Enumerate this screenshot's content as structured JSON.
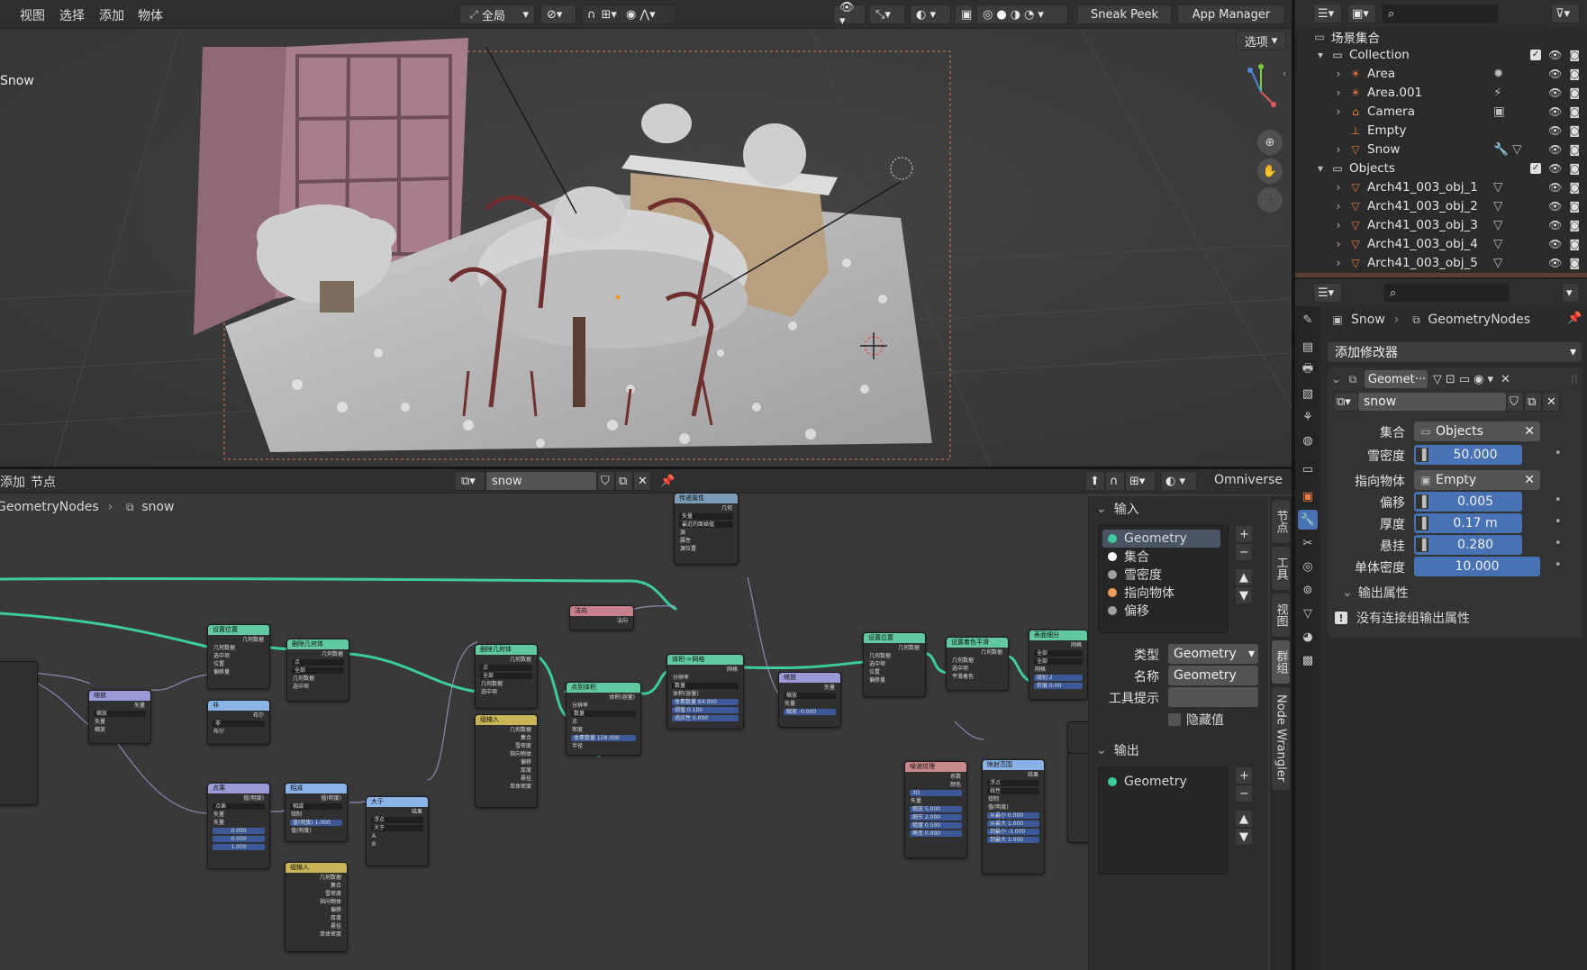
{
  "viewport": {
    "menu": [
      "视图",
      "选择",
      "添加",
      "物体"
    ],
    "orientation": "全局",
    "sneak_peek": "Sneak Peek",
    "app_manager": "App Manager",
    "options": "选项",
    "object_label": "Snow"
  },
  "node_editor": {
    "menu": [
      "添加",
      "节点"
    ],
    "tree_name": "snow",
    "omniverse": "Omniverse",
    "breadcrumb": [
      "GeometryNodes",
      "snow"
    ],
    "tabs": [
      "节点",
      "工具",
      "视图",
      "群组",
      "Node Wrangler"
    ],
    "inputs_header": "输入",
    "inputs": [
      {
        "name": "Geometry",
        "color": "#3dcc9f"
      },
      {
        "name": "集合",
        "color": "#ffffff"
      },
      {
        "name": "雪密度",
        "color": "#a1a1a1"
      },
      {
        "name": "指向物体",
        "color": "#ed9e5c"
      },
      {
        "name": "偏移",
        "color": "#a1a1a1"
      }
    ],
    "type_label": "类型",
    "type_value": "Geometry",
    "name_label": "名称",
    "name_value": "Geometry",
    "tooltip_label": "工具提示",
    "hide_value_label": "隐藏值",
    "outputs_header": "输出",
    "outputs": [
      {
        "name": "Geometry",
        "color": "#3dcc9f"
      }
    ],
    "nodes": [
      {
        "title": "传递属性",
        "color": "#7b9db8",
        "rows": [
          "几何",
          "矢量",
          "最近的面插值",
          "源",
          "属性",
          "源位置"
        ]
      },
      {
        "title": "法向",
        "color": "#c8808a",
        "rows": [
          "法向"
        ]
      },
      {
        "title": "设置位置",
        "color": "#60c9a2",
        "rows": [
          "几何数据",
          "几何数据",
          "选中项",
          "位置",
          "偏移量"
        ]
      },
      {
        "title": "删除几何体",
        "color": "#60c9a2",
        "rows": [
          "几何数据",
          "点",
          "全部",
          "几何数据",
          "选中项"
        ]
      },
      {
        "title": "缩放",
        "color": "#9a9ad8",
        "rows": [
          "矢量",
          "缩放",
          "矢量",
          "缩放"
        ]
      },
      {
        "title": "非",
        "color": "#8ab4e8",
        "rows": [
          "布尔",
          "非",
          "布尔"
        ]
      },
      {
        "title": "删除几何体",
        "color": "#60c9a2",
        "rows": [
          "几何数据",
          "点",
          "全部",
          "几何数据",
          "选中项"
        ]
      },
      {
        "title": "组输入",
        "color": "#c9b457",
        "rows": [
          "几何数据",
          "集合",
          "雪密度",
          "指向物体",
          "偏移",
          "厚度",
          "悬挂",
          "单体密度"
        ]
      },
      {
        "title": "点到体积",
        "color": "#60c9a2",
        "rows": [
          "体积(容量)",
          "分辨率",
          "数量",
          "点",
          "密度",
          "体素数量 128.000",
          "半径"
        ]
      },
      {
        "title": "体积->网格",
        "color": "#60c9a2",
        "rows": [
          "网格",
          "分辨率",
          "数量",
          "体积(容量)",
          "体素数量 64.000",
          "阈值 0.100",
          "适应性 0.000"
        ]
      },
      {
        "title": "缩放",
        "color": "#9a9ad8",
        "rows": [
          "矢量",
          "缩放",
          "矢量",
          "缩放 -0.000"
        ]
      },
      {
        "title": "设置位置",
        "color": "#60c9a2",
        "rows": [
          "几何数据",
          "几何数据",
          "选中项",
          "位置",
          "偏移量"
        ]
      },
      {
        "title": "设置着色平滑",
        "color": "#60c9a2",
        "rows": [
          "几何数据",
          "几何数据",
          "选中项",
          "平滑着色"
        ]
      },
      {
        "title": "表面细分",
        "color": "#60c9a2",
        "rows": [
          "网格",
          "全部",
          "全部",
          "网格",
          "级别 2",
          "折痕 0.00"
        ]
      },
      {
        "title": "点乘",
        "color": "#9a9ad8",
        "rows": [
          "值(明度)",
          "点乘",
          "矢量",
          "矢量",
          "0.000",
          "0.000",
          "1.000"
        ]
      },
      {
        "title": "相减",
        "color": "#8ab4e8",
        "rows": [
          "值(明度)",
          "相减",
          "钳制",
          "值(明度) 1.000",
          "值(明度)"
        ]
      },
      {
        "title": "大于",
        "color": "#8ab4e8",
        "rows": [
          "结果",
          "浮点",
          "大于",
          "A",
          "B"
        ]
      },
      {
        "title": "组输入",
        "color": "#c9b457",
        "rows": [
          "几何数据",
          "集合",
          "雪密度",
          "指向物体",
          "偏移",
          "厚度",
          "悬挂",
          "单体密度"
        ]
      },
      {
        "title": "噪波纹理",
        "color": "#c88a8a",
        "rows": [
          "系数",
          "颜色",
          "3D",
          "矢量",
          "缩放 5.000",
          "细节 2.000",
          "糙度 0.500",
          "畸变 0.000"
        ]
      },
      {
        "title": "映射范围",
        "color": "#8ab4e8",
        "rows": [
          "结果",
          "浮点",
          "线性",
          "钳制",
          "值(明度)",
          "从最小 0.000",
          "从最大 1.000",
          "到最小 -1.000",
          "到最大 1.000"
        ]
      }
    ]
  },
  "outliner": {
    "root": "场景集合",
    "items": [
      {
        "name": "Collection",
        "type": "collection",
        "depth": 1,
        "expanded": true
      },
      {
        "name": "Area",
        "type": "light",
        "depth": 2,
        "extra": "sun-data-icon"
      },
      {
        "name": "Area.001",
        "type": "light",
        "depth": 2,
        "extra": "light-data-icon"
      },
      {
        "name": "Camera",
        "type": "camera",
        "depth": 2,
        "extra": "camera-data-icon"
      },
      {
        "name": "Empty",
        "type": "empty",
        "depth": 2,
        "extra": ""
      },
      {
        "name": "Snow",
        "type": "mesh",
        "depth": 2,
        "extra": "modifier-icon"
      },
      {
        "name": "Objects",
        "type": "collection",
        "depth": 1,
        "expanded": true
      },
      {
        "name": "Arch41_003_obj_1",
        "type": "mesh",
        "depth": 2,
        "extra": "mesh-data-icon"
      },
      {
        "name": "Arch41_003_obj_2",
        "type": "mesh",
        "depth": 2,
        "extra": "mesh-data-icon"
      },
      {
        "name": "Arch41_003_obj_3",
        "type": "mesh",
        "depth": 2,
        "extra": "mesh-data-icon"
      },
      {
        "name": "Arch41_003_obj_4",
        "type": "mesh",
        "depth": 2,
        "extra": "mesh-data-icon"
      },
      {
        "name": "Arch41_003_obj_5",
        "type": "mesh",
        "depth": 2,
        "extra": "mesh-data-icon"
      }
    ]
  },
  "properties": {
    "breadcrumb_object": "Snow",
    "breadcrumb_modifier": "GeometryNodes",
    "add_modifier": "添加修改器",
    "modifier_name": "Geomet···",
    "node_tree": "snow",
    "fields": [
      {
        "label": "集合",
        "value": "Objects",
        "kind": "datablock"
      },
      {
        "label": "雪密度",
        "value": "50.000",
        "kind": "number"
      },
      {
        "label": "指向物体",
        "value": "Empty",
        "kind": "datablock"
      },
      {
        "label": "偏移",
        "value": "0.005",
        "kind": "number"
      },
      {
        "label": "厚度",
        "value": "0.17 m",
        "kind": "number"
      },
      {
        "label": "悬挂",
        "value": "0.280",
        "kind": "number"
      },
      {
        "label": "单体密度",
        "value": "10.000",
        "kind": "number"
      }
    ],
    "output_attributes": "输出属性",
    "no_outputs": "没有连接组输出属性"
  },
  "colors": {
    "geometry": "#3dcc9f",
    "selected": "#4772b3",
    "accent_orange": "#ed7b3d"
  }
}
